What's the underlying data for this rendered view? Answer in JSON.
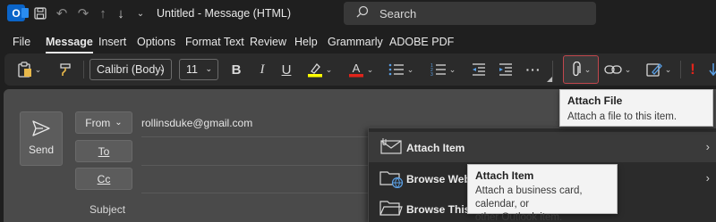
{
  "window": {
    "title": "Untitled  -  Message (HTML)",
    "app_logo": "O"
  },
  "search": {
    "placeholder": "Search"
  },
  "tabs": [
    "File",
    "Message",
    "Insert",
    "Options",
    "Format Text",
    "Review",
    "Help",
    "Grammarly",
    "ADOBE PDF"
  ],
  "active_tab": "Message",
  "ribbon": {
    "font_name": "Calibri (Body)",
    "font_size": "11",
    "bold": "B",
    "italic": "I",
    "underline": "U",
    "more": "···",
    "highlight_color": "#ffff00",
    "font_color": "#e0241b",
    "importance_mark": "!"
  },
  "compose": {
    "send_label": "Send",
    "from_label": "From",
    "from_email": "rollinsduke@gmail.com",
    "to_label": "To",
    "cc_label": "Cc",
    "subject_label": "Subject"
  },
  "tooltip_attach_file": {
    "title": "Attach File",
    "desc": "Attach a file to this item."
  },
  "attach_menu": {
    "items": [
      {
        "label": "Attach Item",
        "icon": "envelope-icon"
      },
      {
        "label": "Browse Web Lo",
        "icon": "web-folder-icon"
      },
      {
        "label": "Browse This PC",
        "icon": "folder-icon"
      }
    ]
  },
  "tooltip_attach_item": {
    "title": "Attach Item",
    "desc_line1": "Attach a business card, calendar, or",
    "desc_line2": "other Outlook item."
  }
}
